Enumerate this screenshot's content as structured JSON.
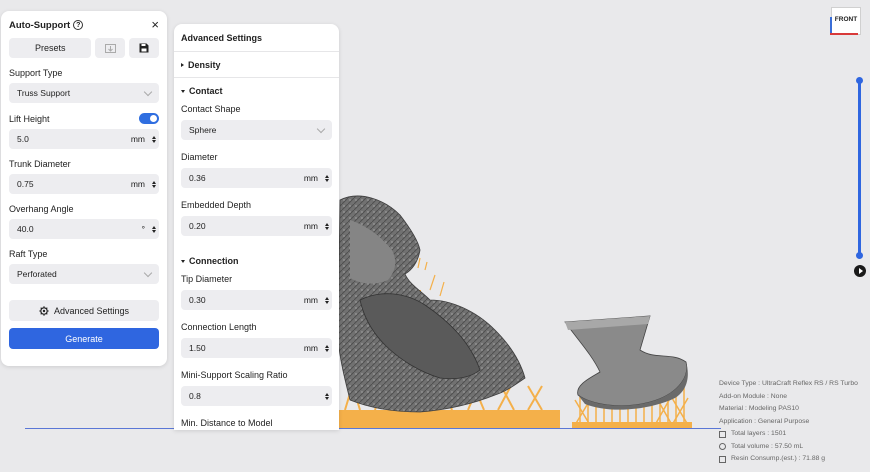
{
  "auto_support": {
    "title": "Auto-Support",
    "help_icon": "?",
    "close_icon": "×",
    "presets_label": "Presets",
    "support_type_label": "Support Type",
    "support_type_value": "Truss Support",
    "lift_height_label": "Lift Height",
    "lift_height_enabled": true,
    "lift_height_value": "5.0",
    "lift_height_unit": "mm",
    "trunk_diameter_label": "Trunk Diameter",
    "trunk_diameter_value": "0.75",
    "trunk_diameter_unit": "mm",
    "overhang_angle_label": "Overhang Angle",
    "overhang_angle_value": "40.0",
    "overhang_angle_unit": "°",
    "raft_type_label": "Raft Type",
    "raft_type_value": "Perforated",
    "advanced_settings_label": "Advanced Settings",
    "generate_label": "Generate"
  },
  "advanced": {
    "title": "Advanced Settings",
    "density_label": "Density",
    "contact_label": "Contact",
    "contact_shape_label": "Contact Shape",
    "contact_shape_value": "Sphere",
    "diameter_label": "Diameter",
    "diameter_value": "0.36",
    "diameter_unit": "mm",
    "embedded_depth_label": "Embedded Depth",
    "embedded_depth_value": "0.20",
    "embedded_depth_unit": "mm",
    "connection_label": "Connection",
    "tip_diameter_label": "Tip Diameter",
    "tip_diameter_value": "0.30",
    "tip_diameter_unit": "mm",
    "connection_length_label": "Connection Length",
    "connection_length_value": "1.50",
    "connection_length_unit": "mm",
    "mini_support_label": "Mini-Support Scaling Ratio",
    "mini_support_value": "0.8",
    "min_distance_label": "Min. Distance to Model"
  },
  "view_cube": {
    "face_label": "FRONT"
  },
  "device_info": {
    "device_type": "Device Type : UltraCraft Reflex RS / RS Turbo",
    "addon_module": "Add-on Module : None",
    "material": "Material : Modeling PAS10",
    "application": "Application : General Purpose",
    "total_layers": "Total layers : 1501",
    "total_volume": "Total volume : 57.50 mL",
    "resin_consumption": "Resin Consump.(est.) : 71.88 g"
  },
  "colors": {
    "accent": "#2f66e0",
    "support": "#f4b04a",
    "model": "#6b6b6b",
    "background": "#e9e9eb"
  }
}
